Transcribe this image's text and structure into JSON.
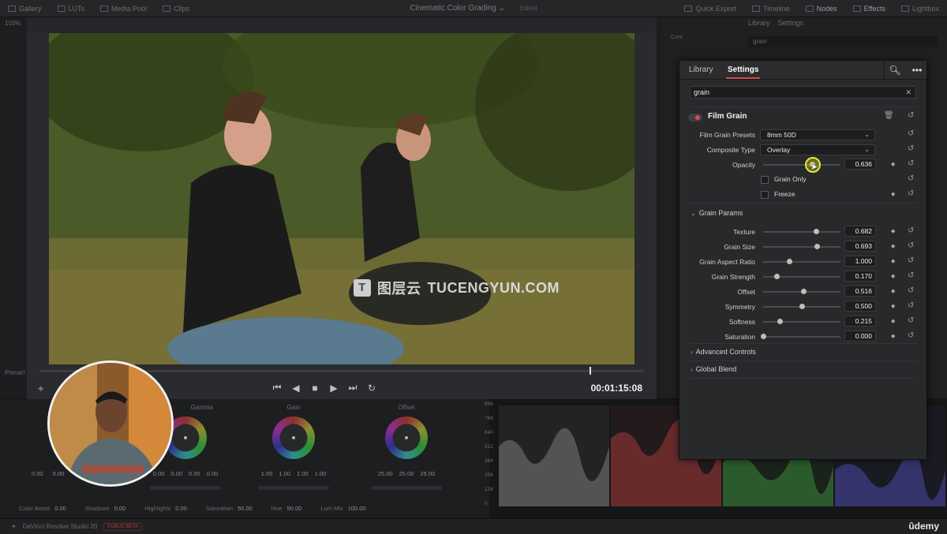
{
  "topbar": {
    "items": [
      "Gallery",
      "LUTs",
      "Media Pool",
      "Clips"
    ],
    "project_title": "Cinematic Color Grading",
    "edited": "Edited",
    "right_items": [
      "Quick Export",
      "Timeline",
      "Nodes",
      "Effects",
      "Lightbox"
    ]
  },
  "viewer": {
    "zoom": "103%",
    "timecode": "00:01:15:08",
    "playhead_fraction": 0.91,
    "watermark_cn": "图层云",
    "watermark_text": "TUCENGYUN.COM"
  },
  "background_right": {
    "tabs": [
      "Library",
      "Settings"
    ],
    "search": "grain",
    "cont_label": "Cont"
  },
  "color_page": {
    "primaries_label": "Primari",
    "wheels": [
      {
        "label": "Gamma",
        "values": [
          "0.00",
          "0.00",
          "0.00",
          "0.00"
        ]
      },
      {
        "label": "Gain",
        "values": [
          "1.00",
          "1.00",
          "1.00",
          "1.00"
        ]
      },
      {
        "label": "Offset",
        "values": [
          "25.00",
          "25.00",
          "25.00"
        ]
      }
    ],
    "lift_values": [
      "0.00",
      "0.00"
    ],
    "bottom_row": [
      {
        "label": "Color Boost",
        "value": "0.00"
      },
      {
        "label": "Shadows",
        "value": "0.00"
      },
      {
        "label": "Highlights",
        "value": "0.00"
      },
      {
        "label": "Saturation",
        "value": "50.00"
      },
      {
        "label": "Hue",
        "value": "50.00"
      },
      {
        "label": "Lum Mix",
        "value": "100.00"
      }
    ],
    "scope_ticks": [
      "896",
      "768",
      "640",
      "512",
      "384",
      "256",
      "128",
      "0"
    ]
  },
  "status": {
    "app_name": "DaVinci Resolve Studio 20",
    "beta": "PUBLIC BETA",
    "brand": "ûdemy"
  },
  "effects_panel": {
    "tabs": {
      "library": "Library",
      "settings": "Settings"
    },
    "search_value": "grain",
    "effect_name": "Film Grain",
    "film_grain_presets_label": "Film Grain Presets",
    "film_grain_presets_value": "8mm 50D",
    "composite_type_label": "Composite Type",
    "composite_type_value": "Overlay",
    "opacity_label": "Opacity",
    "opacity_value": "0.636",
    "opacity_level": 0.636,
    "grain_only_label": "Grain Only",
    "freeze_label": "Freeze",
    "grain_params_label": "Grain Params",
    "grain_params": [
      {
        "label": "Texture",
        "value": "0.682",
        "level": 0.682
      },
      {
        "label": "Grain Size",
        "value": "0.693",
        "level": 0.693
      },
      {
        "label": "Grain Aspect Ratio",
        "value": "1.000",
        "level": 0.34
      },
      {
        "label": "Grain Strength",
        "value": "0.170",
        "level": 0.17
      },
      {
        "label": "Offset",
        "value": "0.516",
        "level": 0.516
      },
      {
        "label": "Symmetry",
        "value": "0.500",
        "level": 0.5
      },
      {
        "label": "Softness",
        "value": "0.215",
        "level": 0.215
      },
      {
        "label": "Saturation",
        "value": "0.000",
        "level": 0.0
      }
    ],
    "advanced_controls_label": "Advanced Controls",
    "global_blend_label": "Global Blend"
  },
  "colors": {
    "accent_red": "#d34a4a",
    "cursor_highlight": "#e8e832"
  }
}
